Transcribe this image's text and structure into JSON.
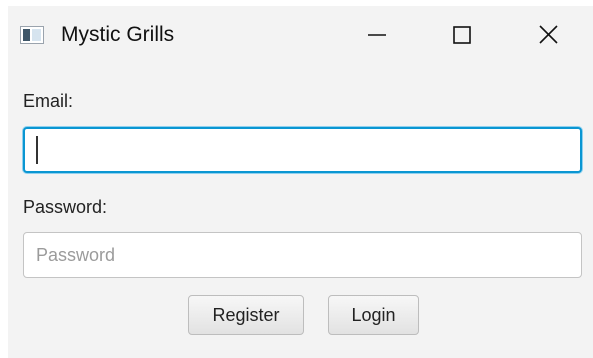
{
  "window": {
    "title": "Mystic Grills",
    "icon": "application-window-icon",
    "controls": [
      "minimize-icon",
      "maximize-icon",
      "close-icon"
    ]
  },
  "form": {
    "email_label": "Email:",
    "email_value": "",
    "email_placeholder": "",
    "password_label": "Password:",
    "password_value": "",
    "password_placeholder": "Password",
    "register_label": "Register",
    "login_label": "Login"
  },
  "colors": {
    "window_background": "#f3f3f3",
    "focus_border": "#0a96d2"
  }
}
